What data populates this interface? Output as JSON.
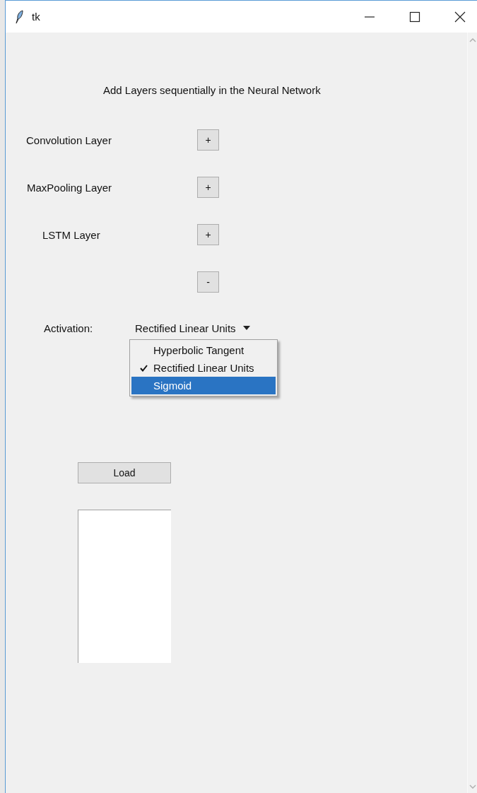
{
  "window": {
    "title": "tk"
  },
  "heading": "Add Layers sequentially in the Neural Network",
  "layers": [
    {
      "label": "Convolution Layer",
      "button": "+"
    },
    {
      "label": "MaxPooling Layer",
      "button": "+"
    },
    {
      "label": "LSTM Layer",
      "button": "+"
    }
  ],
  "remove_button": "-",
  "activation": {
    "label": "Activation:",
    "value": "Rectified Linear Units",
    "menu": [
      {
        "label": "Hyperbolic Tangent",
        "checked": false,
        "highlighted": false
      },
      {
        "label": "Rectified Linear Units",
        "checked": true,
        "highlighted": false
      },
      {
        "label": "Sigmoid",
        "checked": false,
        "highlighted": true
      }
    ]
  },
  "load_button": "Load"
}
